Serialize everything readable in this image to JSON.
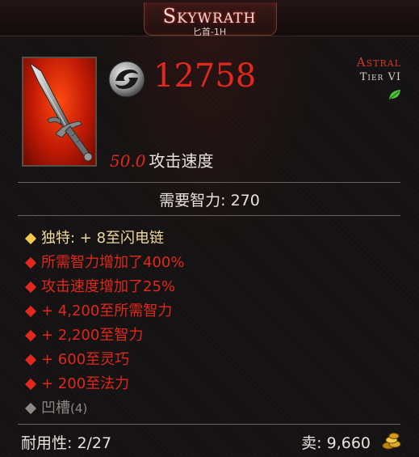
{
  "item": {
    "name": "Skywrath",
    "type": "匕首-1H",
    "damage": "12758",
    "rarity": "Astral",
    "tier": "Tier VI",
    "attack_speed_value": "50.0",
    "attack_speed_label": "攻击速度",
    "requirement": "需要智力: 270"
  },
  "affixes": [
    {
      "kind": "unique",
      "text": "独特: + 8至闪电链"
    },
    {
      "kind": "affix",
      "text": "所需智力增加了400%"
    },
    {
      "kind": "affix",
      "text": "攻击速度增加了25%"
    },
    {
      "kind": "affix",
      "text": "+ 4,200至所需智力"
    },
    {
      "kind": "affix",
      "text": "+ 2,200至智力"
    },
    {
      "kind": "affix",
      "text": "+ 600至灵巧"
    },
    {
      "kind": "affix",
      "text": "+ 200至法力"
    },
    {
      "kind": "socket",
      "text": "凹槽",
      "count": "(4)"
    }
  ],
  "footer": {
    "durability": "耐用性: 2/27",
    "sell": "卖: 9,660"
  },
  "icons": {
    "damage": "swirl-damage-icon",
    "tier": "green-leaf-icon",
    "gold": "gold-coins-icon"
  },
  "colors": {
    "affix": "#e0281d",
    "unique_bullet": "#f2c94c",
    "unique_text": "#efd9a0",
    "socket": "#8c8884",
    "rarity": "#d23a2a"
  }
}
